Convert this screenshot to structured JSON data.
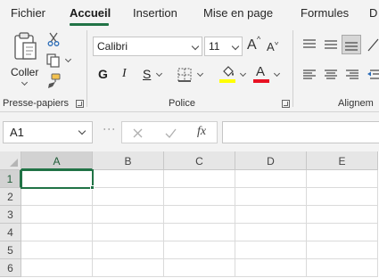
{
  "tabs": [
    {
      "label": "Fichier",
      "active": false
    },
    {
      "label": "Accueil",
      "active": true
    },
    {
      "label": "Insertion",
      "active": false
    },
    {
      "label": "Mise en page",
      "active": false
    },
    {
      "label": "Formules",
      "active": false
    },
    {
      "label": "D",
      "active": false
    }
  ],
  "ribbon": {
    "clipboard": {
      "paste_label": "Coller",
      "group_label": "Presse-papiers"
    },
    "font": {
      "font_name": "Calibri",
      "font_size": "11",
      "grow_label": "A",
      "shrink_label": "A",
      "bold_label": "G",
      "italic_label": "I",
      "underline_label": "S",
      "font_color_label": "A",
      "group_label": "Police",
      "highlight_color": "#ffff00",
      "font_color": "#e81123"
    },
    "alignment": {
      "group_label": "Alignem"
    }
  },
  "formula_bar": {
    "name_box": "A1",
    "cancel_icon": "close-icon",
    "enter_icon": "check-icon",
    "fx_label": "fx",
    "value": ""
  },
  "grid": {
    "columns": [
      "A",
      "B",
      "C",
      "D",
      "E"
    ],
    "rows": [
      "1",
      "2",
      "3",
      "4",
      "5",
      "6"
    ],
    "active_cell": "A1",
    "accent": "#217346"
  }
}
